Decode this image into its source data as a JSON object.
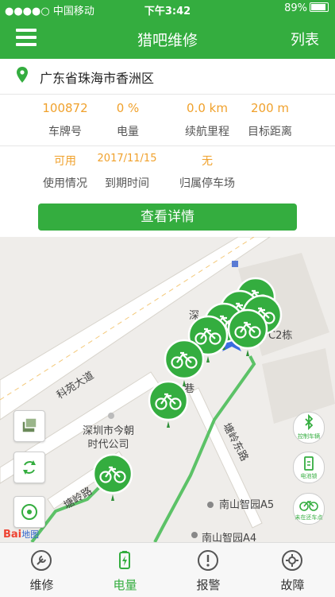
{
  "status_bar": {
    "carrier": "●●●●○ 中国移动",
    "time": "下午3:42",
    "battery": "89%"
  },
  "nav": {
    "title": "猎吧维修",
    "right_label": "列表"
  },
  "address": "广东省珠海市香洲区",
  "stats": [
    {
      "value": "100872",
      "label": "车牌号"
    },
    {
      "value": "0 %",
      "label": "电量"
    },
    {
      "value": "0.0 km",
      "label": "续航里程"
    },
    {
      "value": "200 m",
      "label": "目标距离"
    }
  ],
  "info": [
    {
      "value": "可用",
      "label": "使用情况"
    },
    {
      "value": "2017/11/15",
      "label": "到期时间"
    },
    {
      "value": "无",
      "label": "归属停车场"
    }
  ],
  "detail_button": "查看详情",
  "map": {
    "labels": {
      "road_main": "科苑大道",
      "poi_company": "深圳市今朝\n时代公司",
      "road_tangling": "塘岭路",
      "road_tangling_east": "塘岭东路",
      "poi_a5": "南山智园A5",
      "poi_a4": "南山智园A4",
      "poi_c2": "C2栋",
      "partial_1": "深",
      "partial_2": "巷"
    },
    "right_buttons": [
      "控制车辆",
      "电池锁",
      "未在还车点"
    ],
    "provider": "Bai",
    "provider_suffix": "地图"
  },
  "tabs": [
    {
      "label": "维修",
      "active": false
    },
    {
      "label": "电量",
      "active": true
    },
    {
      "label": "报警",
      "active": false
    },
    {
      "label": "故障",
      "active": false
    }
  ],
  "colors": {
    "primary": "#34ad3f",
    "value": "#f0a12c"
  }
}
